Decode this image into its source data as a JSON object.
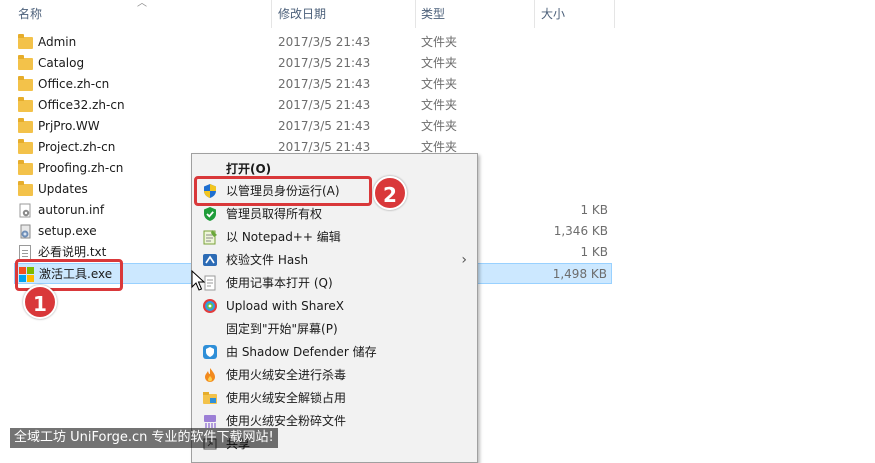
{
  "columns": {
    "name": "名称",
    "modified": "修改日期",
    "type": "类型",
    "size": "大小"
  },
  "files": [
    {
      "name": "Admin",
      "date": "2017/3/5 21:43",
      "type": "文件夹",
      "size": "",
      "icon": "folder-icon"
    },
    {
      "name": "Catalog",
      "date": "2017/3/5 21:43",
      "type": "文件夹",
      "size": "",
      "icon": "folder-icon"
    },
    {
      "name": "Office.zh-cn",
      "date": "2017/3/5 21:43",
      "type": "文件夹",
      "size": "",
      "icon": "folder-icon"
    },
    {
      "name": "Office32.zh-cn",
      "date": "2017/3/5 21:43",
      "type": "文件夹",
      "size": "",
      "icon": "folder-icon"
    },
    {
      "name": "PrjPro.WW",
      "date": "2017/3/5 21:43",
      "type": "文件夹",
      "size": "",
      "icon": "folder-icon"
    },
    {
      "name": "Project.zh-cn",
      "date": "2017/3/5 21:43",
      "type": "文件夹",
      "size": "",
      "icon": "folder-icon"
    },
    {
      "name": "Proofing.zh-cn",
      "date": "",
      "type": "",
      "size": "",
      "icon": "folder-icon"
    },
    {
      "name": "Updates",
      "date": "",
      "type": "",
      "size": "",
      "icon": "folder-icon"
    },
    {
      "name": "autorun.inf",
      "date": "",
      "type": "",
      "size": "1 KB",
      "icon": "settings-file-icon"
    },
    {
      "name": "setup.exe",
      "date": "",
      "type": "",
      "size": "1,346 KB",
      "icon": "setup-exe-icon"
    },
    {
      "name": "必看说明.txt",
      "date": "",
      "type": "",
      "size": "1 KB",
      "icon": "text-file-icon"
    },
    {
      "name": "激活工具.exe",
      "date": "",
      "type": "",
      "size": "1,498 KB",
      "icon": "windows-logo-icon",
      "selected": true
    }
  ],
  "context_menu": {
    "items": [
      {
        "label": "打开(O)",
        "icon": "",
        "bold": true
      },
      {
        "label": "以管理员身份运行(A)",
        "icon": "uac-shield-icon"
      },
      {
        "label": "管理员取得所有权",
        "icon": "green-shield-check-icon"
      },
      {
        "label": "以 Notepad++ 编辑",
        "icon": "notepadpp-icon"
      },
      {
        "label": "校验文件 Hash",
        "icon": "hash-icon",
        "submenu": true
      },
      {
        "label": "使用记事本打开 (Q)",
        "icon": "notepad-icon"
      },
      {
        "label": "Upload with ShareX",
        "icon": "sharex-icon"
      },
      {
        "label": "固定到\"开始\"屏幕(P)",
        "icon": ""
      },
      {
        "label": "由 Shadow Defender 储存",
        "icon": "shadow-defender-icon"
      },
      {
        "label": "使用火绒安全进行杀毒",
        "icon": "huorong-icon"
      },
      {
        "label": "使用火绒安全解锁占用",
        "icon": "unlock-folder-icon"
      },
      {
        "label": "使用火绒安全粉碎文件",
        "icon": "shred-icon"
      },
      {
        "label": "共享",
        "icon": "share-icon"
      }
    ]
  },
  "annotations": {
    "badge1": "1",
    "badge2": "2"
  },
  "watermark": "全域工坊 UniForge.cn 专业的软件下载网站!",
  "colors": {
    "accent_red": "#d9383a",
    "selection": "#cce8ff",
    "folder": "#f3c24a"
  }
}
